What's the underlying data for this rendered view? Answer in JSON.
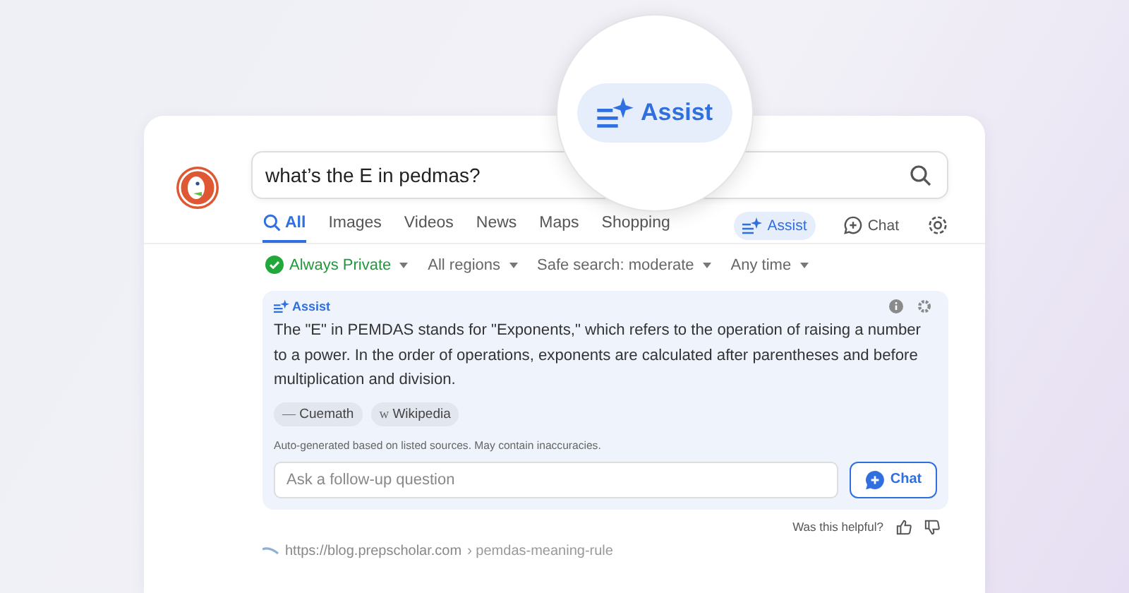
{
  "magnifier": {
    "label": "Assist"
  },
  "search": {
    "value": "what’s the E in pedmas?"
  },
  "tabs": [
    {
      "label": "All",
      "selected": true
    },
    {
      "label": "Images",
      "selected": false
    },
    {
      "label": "Videos",
      "selected": false
    },
    {
      "label": "News",
      "selected": false
    },
    {
      "label": "Maps",
      "selected": false
    },
    {
      "label": "Shopping",
      "selected": false
    }
  ],
  "modes": [
    {
      "label": "Assist",
      "kind": "assist",
      "selected": true
    },
    {
      "label": "Chat",
      "kind": "chat",
      "selected": false
    }
  ],
  "filters": [
    {
      "label": "Always Private",
      "kind": "private"
    },
    {
      "label": "All regions",
      "kind": "plain"
    },
    {
      "label": "Safe search: moderate",
      "kind": "plain"
    },
    {
      "label": "Any time",
      "kind": "plain"
    }
  ],
  "assist_panel": {
    "title": "Assist",
    "answer": "The \"E\" in PEMDAS stands for \"Exponents,\" which refers to the operation of raising a number to a power. In the order of operations, exponents are calculated after parentheses and before multiplication and division.",
    "sources": [
      {
        "icon": "—",
        "label": "Cuemath"
      },
      {
        "icon": "w",
        "label": "Wikipedia"
      }
    ],
    "disclaimer": "Auto-generated based on listed sources. May contain inaccuracies.",
    "followup": {
      "placeholder": "Ask a follow-up question"
    },
    "chat_button": "Chat"
  },
  "feedback": {
    "question": "Was this helpful?"
  },
  "result": {
    "url": "https://blog.prepscholar.com",
    "path": "› pemdas-meaning-rule"
  }
}
